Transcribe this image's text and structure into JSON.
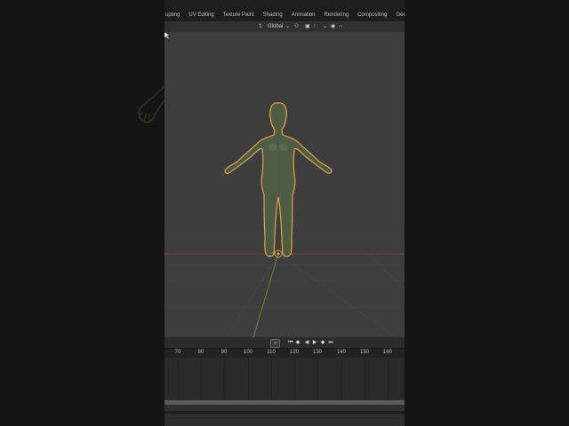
{
  "workspace_tabs": [
    "Sculpting",
    "UV Editing",
    "Texture Paint",
    "Shading",
    "Animation",
    "Rendering",
    "Compositing",
    "Geometry Nodes"
  ],
  "first_tab_visible": "upting",
  "viewport_header": {
    "transform_orientation": "Global"
  },
  "timeline": {
    "frame_labels": [
      "70",
      "80",
      "90",
      "100",
      "110",
      "120",
      "130",
      "140",
      "150",
      "160"
    ],
    "controls": [
      "jump-start",
      "prev-keyframe",
      "play-reverse",
      "play",
      "next-keyframe",
      "jump-end"
    ]
  },
  "colors": {
    "viewport_bg": "#3d3d3d",
    "selection_outline": "#e0a24a",
    "mesh": "#4f5c44",
    "x_axis": "#8a3a3a",
    "y_axis": "#6b8e3a"
  },
  "scene": {
    "object": "female-base-mesh",
    "selected": true
  }
}
